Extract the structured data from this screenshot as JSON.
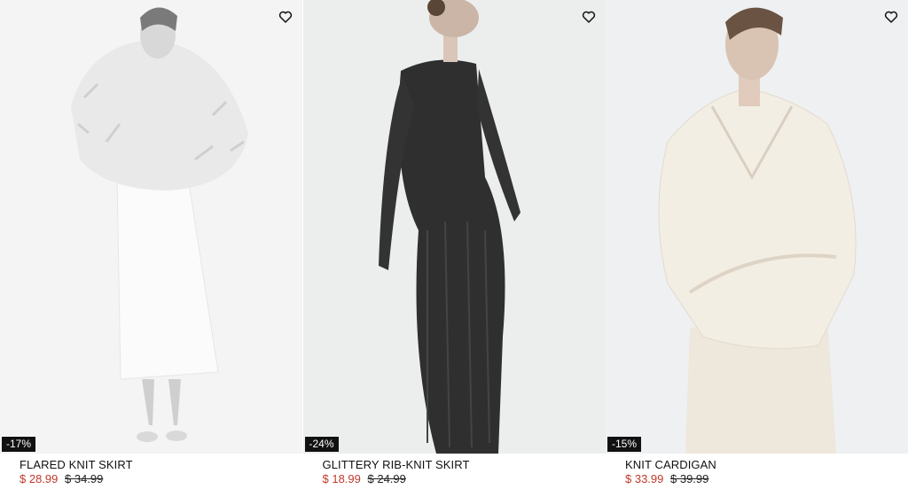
{
  "products": [
    {
      "name": "FLARED KNIT SKIRT",
      "discount": "-17%",
      "sale_price": "$ 28.99",
      "original_price": "$ 34.99",
      "image": "model in white fur jacket and white knit skirt",
      "favorite_icon": "heart-outline-icon"
    },
    {
      "name": "GLITTERY RIB-KNIT SKIRT",
      "discount": "-24%",
      "sale_price": "$ 18.99",
      "original_price": "$ 24.99",
      "image": "model in black glittery knit top and skirt",
      "favorite_icon": "heart-outline-icon"
    },
    {
      "name": "KNIT CARDIGAN",
      "discount": "-15%",
      "sale_price": "$ 33.99",
      "original_price": "$ 39.99",
      "image": "model in cream wrap knit cardigan",
      "favorite_icon": "heart-outline-icon"
    }
  ],
  "colors": {
    "sale": "#c0392b",
    "badge_bg": "#111111"
  }
}
